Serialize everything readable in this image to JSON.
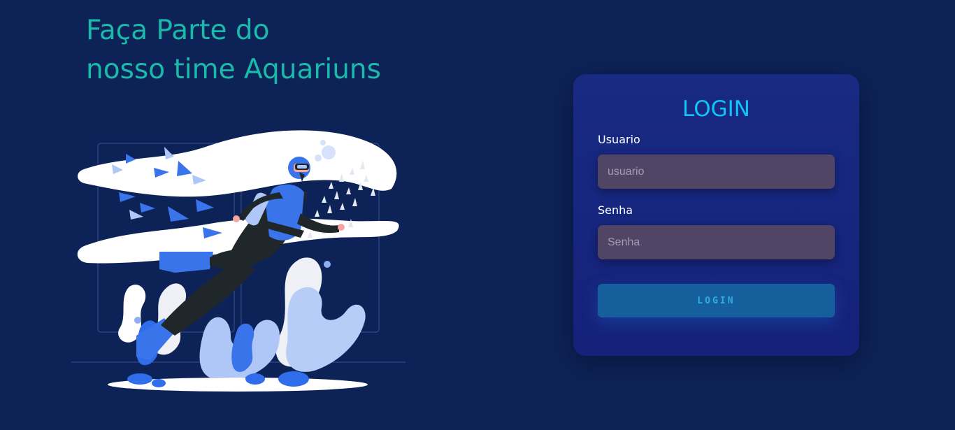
{
  "hero": {
    "line1": "Faça Parte do",
    "line2": "nosso time Aquariuns"
  },
  "login_card": {
    "title": "LOGIN",
    "username": {
      "label": "Usuario",
      "placeholder": "usuario",
      "value": ""
    },
    "password": {
      "label": "Senha",
      "placeholder": "Senha",
      "value": ""
    },
    "submit_label": "LOGIN"
  },
  "illustration": {
    "icon": "scuba-diver-illustration"
  },
  "colors": {
    "background": "#0d2257",
    "hero_text": "#1bb9a9",
    "card": "#172580",
    "card_title": "#0fc5f6",
    "input": "#514566",
    "button": "#155f9c",
    "button_text": "#2eaee2"
  }
}
